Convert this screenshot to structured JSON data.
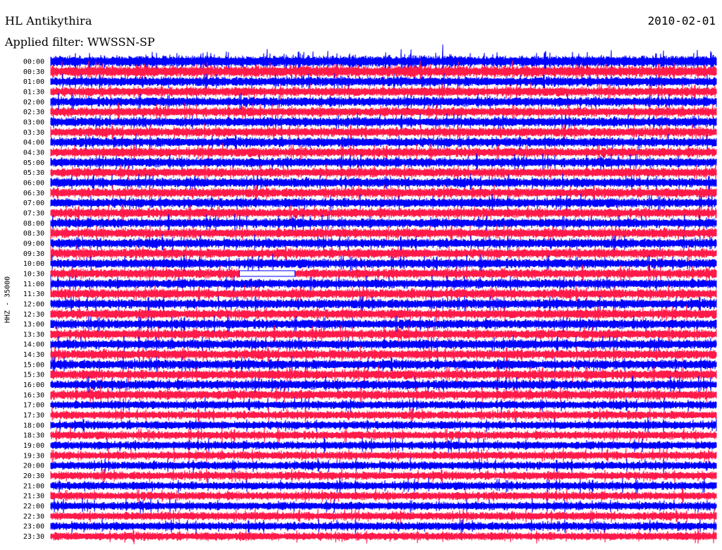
{
  "header": {
    "station": "HL Antikythira",
    "date": "2010-02-01",
    "filter": "Applied filter: WWSSN-SP"
  },
  "colors": {
    "trace_a": "#0000ff",
    "trace_b": "#ff1a4a",
    "gap": "#ffffff",
    "background": "#ffffff",
    "text": "#000000"
  },
  "chart_data": {
    "type": "line",
    "chart_kind": "helicorder",
    "ylabel": "HHZ - 35000",
    "row_interval_minutes": 30,
    "rows": [
      "00:00",
      "00:30",
      "01:00",
      "01:30",
      "02:00",
      "02:30",
      "03:00",
      "03:30",
      "04:00",
      "04:30",
      "05:00",
      "05:30",
      "06:00",
      "06:30",
      "07:00",
      "07:30",
      "08:00",
      "08:30",
      "09:00",
      "09:30",
      "10:00",
      "10:30",
      "11:00",
      "11:30",
      "12:00",
      "12:30",
      "13:00",
      "13:30",
      "14:00",
      "14:30",
      "15:00",
      "15:30",
      "16:00",
      "16:30",
      "17:00",
      "17:30",
      "18:00",
      "18:30",
      "19:00",
      "19:30",
      "20:00",
      "20:30",
      "21:00",
      "21:30",
      "22:00",
      "22:30",
      "23:00",
      "23:30"
    ],
    "series_colors_alternate": [
      "#0000ff",
      "#ff1a4a"
    ],
    "gaps": [
      {
        "row": "10:30",
        "start_minute": 8.5,
        "end_minute": 11.0
      }
    ],
    "grid": false,
    "legend": "none"
  }
}
